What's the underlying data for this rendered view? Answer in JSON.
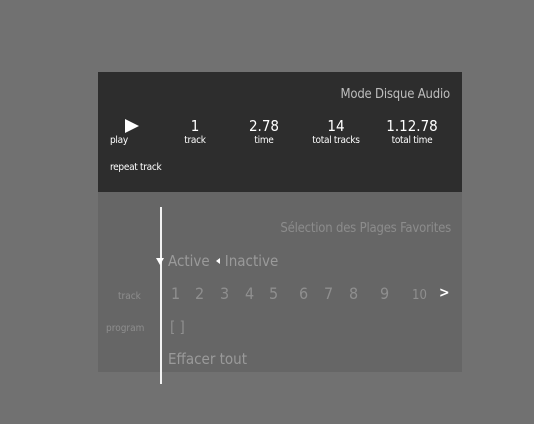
{
  "now_playing": {
    "mode_title": "Mode Disque Audio",
    "play_label": "play",
    "repeat_label": "repeat track",
    "track_value": "1",
    "track_label": "track",
    "time_value": "2.78",
    "time_label": "time",
    "total_tracks_value": "14",
    "total_tracks_label": "total tracks",
    "total_time_value": "1.12.78",
    "total_time_label": "total time"
  },
  "favorites": {
    "title": "Sélection des Plages Favorites",
    "active_label": "Active",
    "inactive_label": "Inactive",
    "track_row_label": "track",
    "program_row_label": "program",
    "tracks": [
      "1",
      "2",
      "3",
      "4",
      "5",
      "6",
      "7",
      "8",
      "9",
      "10"
    ],
    "next_symbol": ">",
    "program_value": "[ ]",
    "clear_all_label": "Effacer tout"
  },
  "colors": {
    "background": "#717171",
    "top_panel": "#2d2d2d",
    "bottom_panel": "#666666"
  }
}
